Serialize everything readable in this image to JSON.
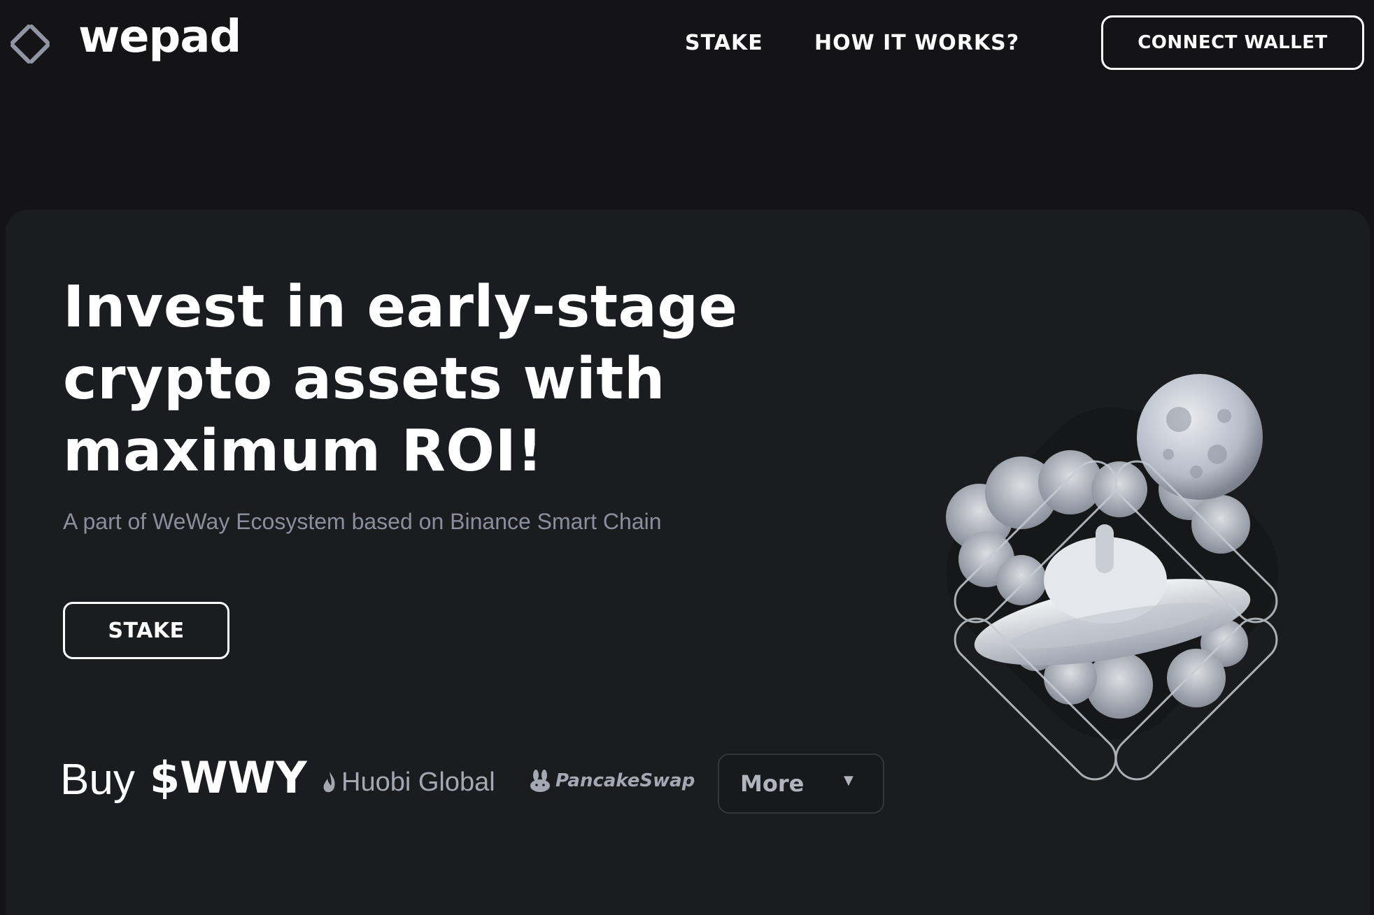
{
  "header": {
    "brand": "wepad",
    "logo_icon": "diamond-outline-icon",
    "nav": {
      "stake": "STAKE",
      "how_it_works": "HOW IT WORKS?"
    },
    "connect_wallet": "CONNECT WALLET"
  },
  "hero": {
    "headline_lines": [
      "Invest in early-stage",
      "crypto assets with",
      "maximum ROI!"
    ],
    "subline": "A part of WeWay Ecosystem based on Binance Smart Chain",
    "stake_button": "STAKE",
    "illustration": "ufo-moon-clouds-illustration"
  },
  "buy": {
    "word": "Buy",
    "ticker": "$WWY",
    "exchanges": [
      {
        "name": "Huobi Global",
        "icon": "huobi-flame-icon"
      },
      {
        "name": "PancakeSwap",
        "icon": "pancake-bunny-icon"
      }
    ],
    "more_label": "More",
    "more_caret": "▼"
  },
  "colors": {
    "background": "#141416",
    "card": "#1b1c1f",
    "text": "#ffffff",
    "muted": "#8a8f9c"
  }
}
